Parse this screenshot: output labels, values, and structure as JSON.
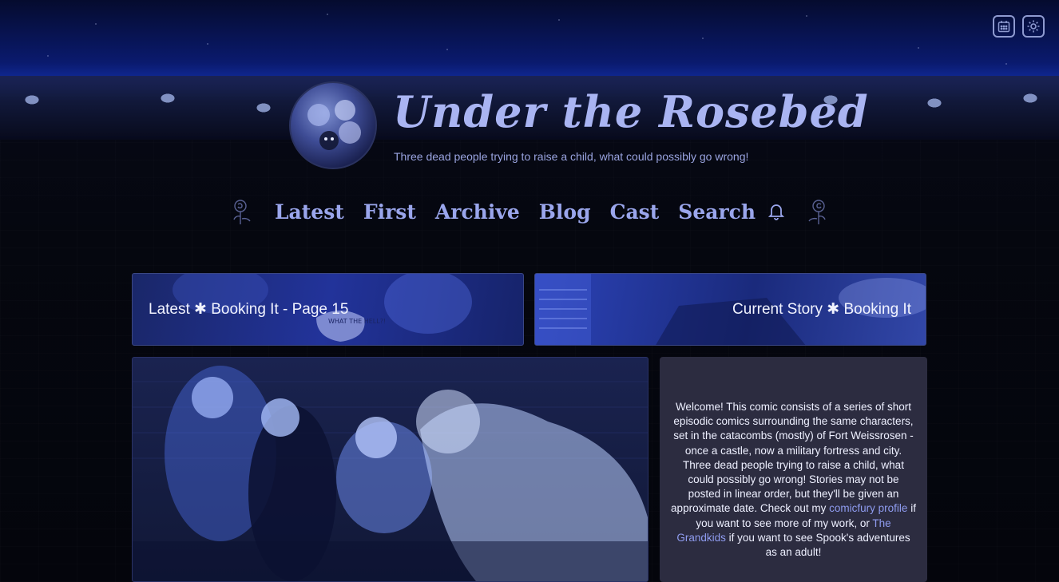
{
  "header": {
    "title": "Under the Rosebed",
    "tagline": "Three dead people trying to raise a child, what could possibly go wrong!",
    "icons": [
      "calendar-icon",
      "settings-icon"
    ]
  },
  "nav": {
    "items": [
      {
        "label": "Latest"
      },
      {
        "label": "First"
      },
      {
        "label": "Archive"
      },
      {
        "label": "Blog"
      },
      {
        "label": "Cast"
      },
      {
        "label": "Search"
      }
    ],
    "notify_icon": "bell-icon"
  },
  "banners": {
    "latest": "Latest ✱ Booking It - Page 15",
    "current": "Current Story ✱ Booking It"
  },
  "comic_art": {
    "speech_bubble": "WHAT THE HELL?!"
  },
  "welcome": {
    "text_before_link1": "Welcome! This comic consists of a series of short episodic comics surrounding the same characters, set in the catacombs (mostly) of Fort Weissrosen - once a castle, now a military fortress and city. Three dead people trying to raise a child, what could possibly go wrong! Stories may not be posted in linear order, but they'll be given an approximate date. Check out my ",
    "link1": "comicfury profile",
    "text_between": " if you want to see more of my work, or ",
    "link2": "The Grandkids",
    "text_after": " if you want to see Spook's adventures as an adult!"
  },
  "colors": {
    "nav_text": "#9aa6ec",
    "title_text": "#a9b4f2",
    "welcome_bg": "#2c2c40",
    "link": "#8f9cf0"
  }
}
